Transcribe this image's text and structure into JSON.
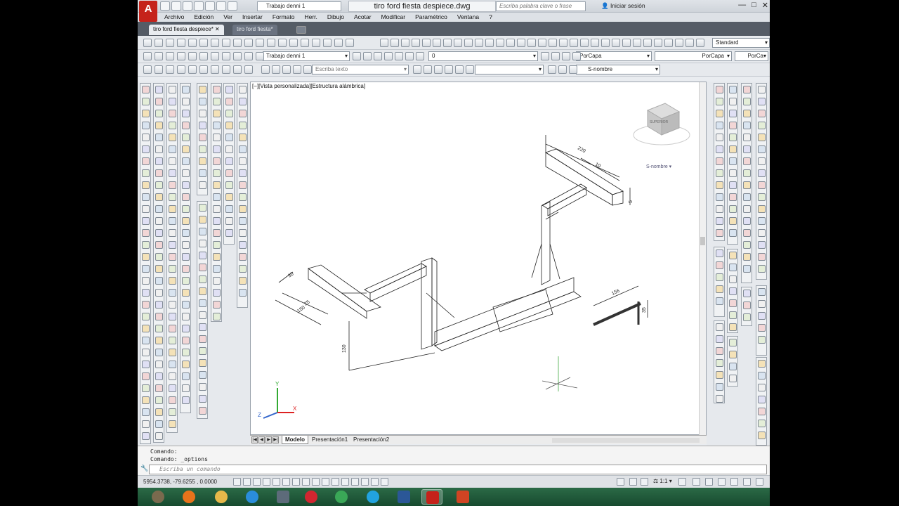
{
  "app": {
    "logo_letter": "A",
    "workspace": "Trabajo denni 1",
    "document_title": "tiro ford fiesta despiece.dwg",
    "search_placeholder": "Escriba palabra clave o frase",
    "login_label": "Iniciar sesión",
    "window_buttons": [
      "—",
      "□",
      "✕"
    ]
  },
  "menu": [
    "Archivo",
    "Edición",
    "Ver",
    "Insertar",
    "Formato",
    "Herr.",
    "Dibujo",
    "Acotar",
    "Modificar",
    "Paramétrico",
    "Ventana",
    "?"
  ],
  "file_tabs": [
    {
      "label": "tiro ford fiesta despiece*",
      "active": true
    },
    {
      "label": "tiro ford fiesta*",
      "active": false
    }
  ],
  "toolbars": {
    "text_style": "Standard",
    "workspace_combo": "Trabajo denni 1",
    "layer_combo": "0",
    "color_combo": "PorCapa",
    "linetype_combo": "PorCapa",
    "lineweight_combo": "PorCa",
    "find_text_placeholder": "Escriba texto",
    "dimstyle_combo": "S-nombre"
  },
  "viewport": {
    "label": "[−][Vista personalizada][Estructura alámbrica]",
    "ucs_name": "S-nombre",
    "viewcube_face": "SUPERIOR",
    "dimensions": [
      "220",
      "10",
      "5",
      "30",
      "25",
      "150",
      "130",
      "156",
      "35"
    ]
  },
  "layout_tabs": [
    "Modelo",
    "Presentación1",
    "Presentación2"
  ],
  "command": {
    "history": [
      "Comando:",
      "Comando: _options"
    ],
    "placeholder": "Escriba un comando"
  },
  "status": {
    "coordinates": "5954.3738, -79.6255 , 0.0000",
    "annotation_scale": "1:1"
  },
  "taskbar_apps": [
    "gimp",
    "firefox",
    "explorer",
    "ie",
    "calculator",
    "opera",
    "chrome",
    "skype",
    "word",
    "autocad",
    "powerpoint"
  ],
  "colors": {
    "autocad_red": "#c5221a",
    "taskbar_green": "#1f5a39",
    "tab_bar": "#555c66"
  }
}
